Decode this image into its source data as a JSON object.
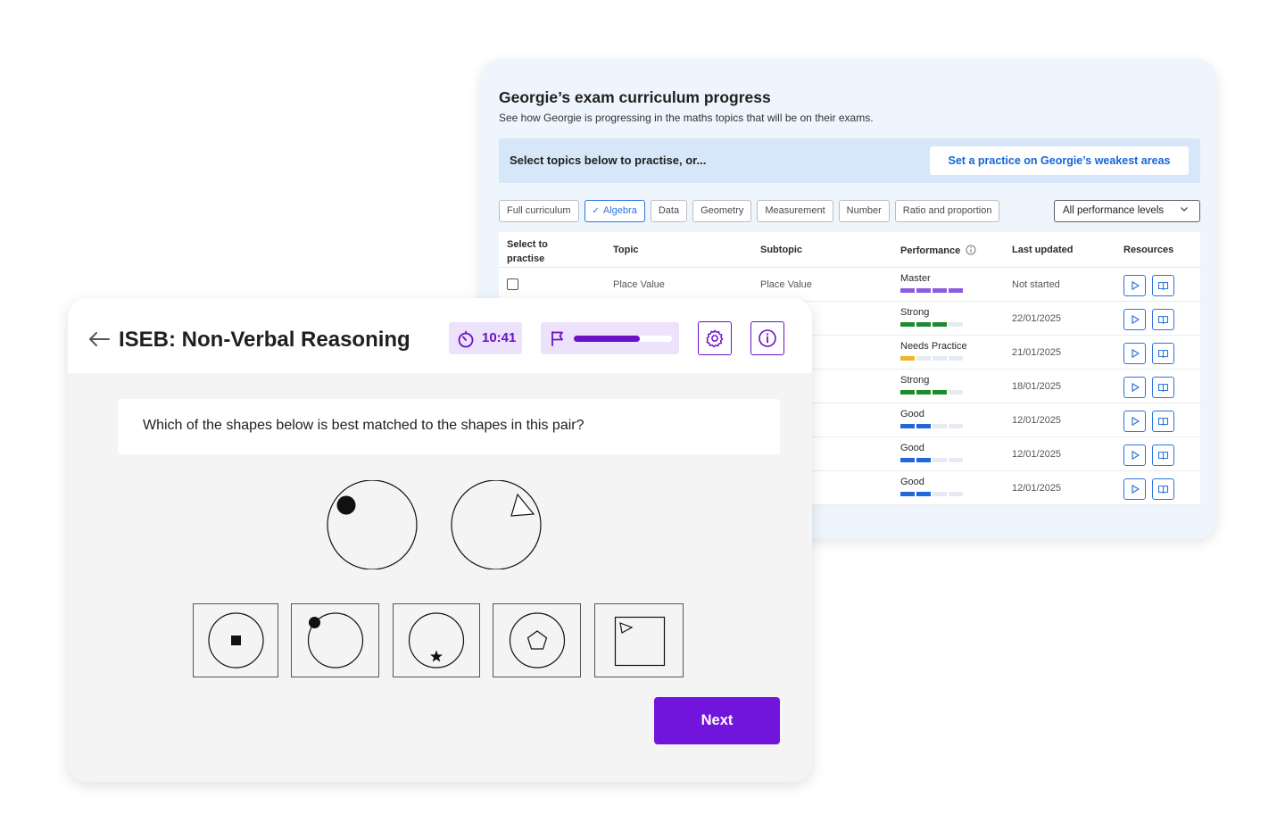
{
  "progress": {
    "title": "Georgie’s exam curriculum progress",
    "subtitle": "See how Georgie is progressing in the maths topics that will be on their exams.",
    "cta_text": "Select topics below to practise, or...",
    "cta_button": "Set a practice on Georgie’s weakest areas",
    "filters": [
      {
        "label": "Full curriculum",
        "active": false
      },
      {
        "label": "Algebra",
        "active": true
      },
      {
        "label": "Data",
        "active": false
      },
      {
        "label": "Geometry",
        "active": false
      },
      {
        "label": "Measurement",
        "active": false
      },
      {
        "label": "Number",
        "active": false
      },
      {
        "label": "Ratio and proportion",
        "active": false
      }
    ],
    "performance_select": "All performance levels",
    "columns": {
      "select_line1": "Select to",
      "select_line2": "practise",
      "topic": "Topic",
      "subtopic": "Subtopic",
      "performance": "Performance",
      "last_updated": "Last updated",
      "resources": "Resources"
    },
    "rows": [
      {
        "topic": "Place Value",
        "subtopic": "Place Value",
        "performance": "Master",
        "level": 4,
        "color": "#8a5ce0",
        "updated": "Not started"
      },
      {
        "topic": "",
        "subtopic": "",
        "performance": "Strong",
        "level": 3,
        "color": "#1e8a2e",
        "updated": "22/01/2025"
      },
      {
        "topic": "",
        "subtopic": "",
        "performance": "Needs Practice",
        "level": 1,
        "color": "#f2b526",
        "updated": "21/01/2025"
      },
      {
        "topic": "",
        "subtopic": "",
        "performance": "Strong",
        "level": 3,
        "color": "#1e8a2e",
        "updated": "18/01/2025"
      },
      {
        "topic": "",
        "subtopic": "",
        "performance": "Good",
        "level": 2,
        "color": "#2268d8",
        "updated": "12/01/2025"
      },
      {
        "topic": "",
        "subtopic": "",
        "performance": "Good",
        "level": 2,
        "color": "#2268d8",
        "updated": "12/01/2025"
      },
      {
        "topic": "",
        "subtopic": "",
        "performance": "Good",
        "level": 2,
        "color": "#2268d8",
        "updated": "12/01/2025"
      }
    ]
  },
  "nvr": {
    "title": "ISEB: Non-Verbal Reasoning",
    "timer": "10:41",
    "progress_fraction": 0.67,
    "question": "Which of the shapes below is best matched to the shapes in this pair?",
    "next_label": "Next",
    "accent": "#7215dc"
  }
}
